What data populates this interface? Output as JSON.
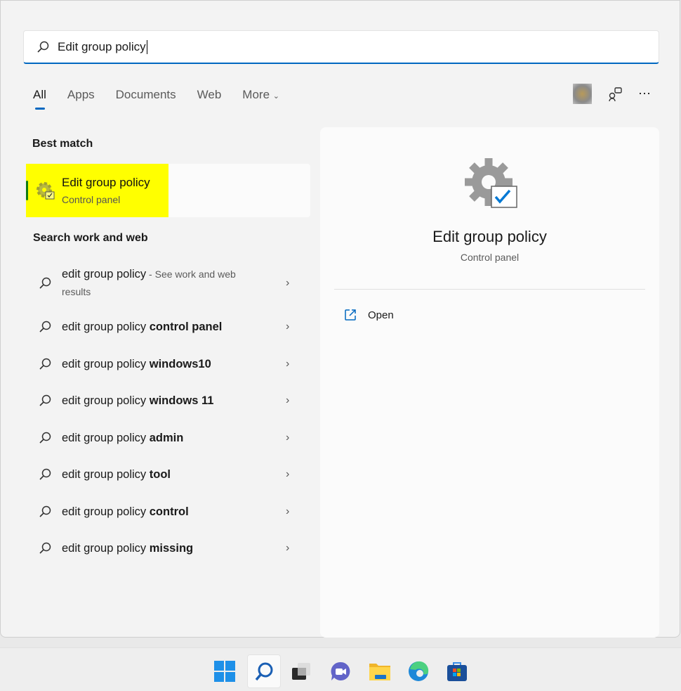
{
  "search": {
    "value": "Edit group policy",
    "icon": "search-icon"
  },
  "tabs": [
    {
      "label": "All",
      "active": true
    },
    {
      "label": "Apps"
    },
    {
      "label": "Documents"
    },
    {
      "label": "Web"
    },
    {
      "label": "More"
    }
  ],
  "best_match": {
    "heading": "Best match",
    "title": "Edit group policy",
    "subtitle": "Control panel",
    "highlight_color": "#ffff00"
  },
  "web": {
    "heading": "Search work and web",
    "items": [
      {
        "prefix": "edit group policy",
        "bold": "",
        "suffix": " - See work and web results"
      },
      {
        "prefix": "edit group policy ",
        "bold": "control panel"
      },
      {
        "prefix": "edit group policy ",
        "bold": "windows10"
      },
      {
        "prefix": "edit group policy ",
        "bold": "windows 11"
      },
      {
        "prefix": "edit group policy ",
        "bold": "admin"
      },
      {
        "prefix": "edit group policy ",
        "bold": "tool"
      },
      {
        "prefix": "edit group policy ",
        "bold": "control"
      },
      {
        "prefix": "edit group policy ",
        "bold": "missing"
      }
    ]
  },
  "preview": {
    "title": "Edit group policy",
    "subtitle": "Control panel",
    "open_label": "Open"
  },
  "taskbar": [
    "start",
    "search",
    "task-view",
    "teams-chat",
    "file-explorer",
    "edge",
    "store"
  ],
  "accent": "#0067c0"
}
